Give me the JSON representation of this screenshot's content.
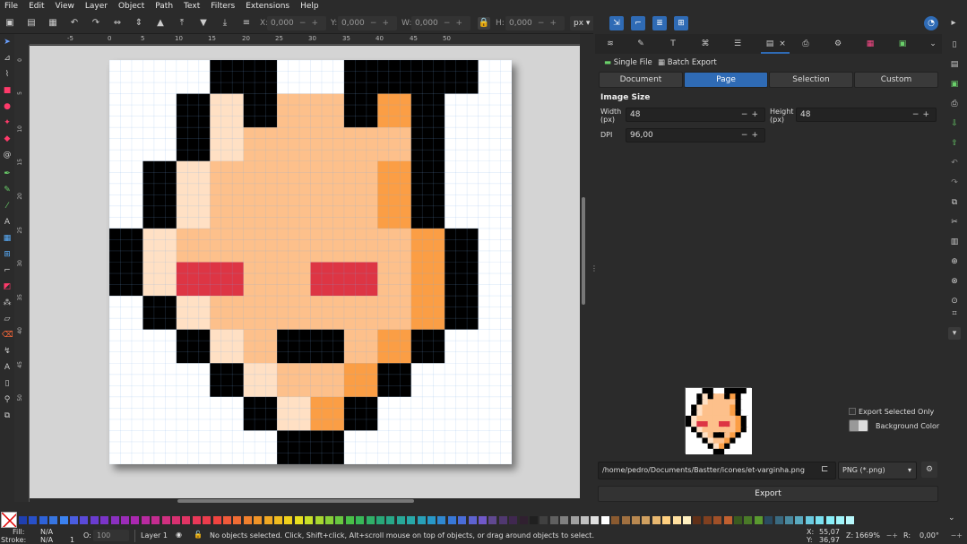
{
  "menu": [
    "File",
    "Edit",
    "View",
    "Layer",
    "Object",
    "Path",
    "Text",
    "Filters",
    "Extensions",
    "Help"
  ],
  "toolbar": {
    "x_label": "X:",
    "x_value": "0,000",
    "y_label": "Y:",
    "y_value": "0,000",
    "w_label": "W:",
    "w_value": "0,000",
    "h_label": "H:",
    "h_value": "0,000",
    "unit": "px"
  },
  "ruler_h": [
    "-5",
    "0",
    "5",
    "10",
    "15",
    "20",
    "25",
    "30",
    "35",
    "40",
    "45",
    "50"
  ],
  "ruler_v": [
    "0",
    "5",
    "10",
    "15",
    "20",
    "25",
    "30",
    "35",
    "40",
    "45",
    "50"
  ],
  "pixel_art": {
    "cols": 12,
    "rows": 12,
    "palette": {
      "0": "#ffffff",
      "K": "#000000",
      "L": "#ffe0c4",
      "S": "#fdc08b",
      "O": "#fb9e45",
      "R": "#dd3544"
    },
    "grid": [
      "000KK00KKKK0",
      "00KLKSSKOK00",
      "00KLSSSSSK00",
      "0KLSSSSSOK0",
      "0KLSSSSSOK0",
      "KLSSSSSSSOK",
      "KLRRSSRRSOK",
      "0KLSSSSSSOK",
      "00KLSKKSOK00",
      "000KLSSOK000",
      "0000KLOK0000",
      "00000KK00000"
    ]
  },
  "dock": {
    "tab_close": "×",
    "subtabs": [
      "Single File",
      "Batch Export"
    ],
    "segments": [
      "Document",
      "Page",
      "Selection",
      "Custom"
    ],
    "active_segment": "Page",
    "image_size_label": "Image Size",
    "width_label": "Width (px)",
    "width_value": "48",
    "height_label": "Height (px)",
    "height_value": "48",
    "dpi_label": "DPI",
    "dpi_value": "96,00",
    "export_selected_only": "Export Selected Only",
    "background_color": "Background Color",
    "filename": "/home/pedro/Documents/Bastter/icones/et-varginha.png",
    "format": "PNG (*.png)",
    "export_button": "Export"
  },
  "status": {
    "fill_label": "Fill:",
    "fill_value": "N/A",
    "stroke_label": "Stroke:",
    "stroke_value": "N/A",
    "stroke_width": "1",
    "opacity_label": "O:",
    "opacity_value": "100",
    "layer": "Layer 1",
    "message": "No objects selected. Click, Shift+click, Alt+scroll mouse on top of objects, or drag around objects to select.",
    "x_label": "X:",
    "x_value": "55,07",
    "y_label": "Y:",
    "y_value": "36,97",
    "zoom_label": "Z:",
    "zoom_value": "1669%",
    "rot_label": "R:",
    "rot_value": "0,00°"
  },
  "palette_colors": [
    "#1f3fb0",
    "#2850c8",
    "#2e62d8",
    "#3775e0",
    "#3b82f0",
    "#4a5de0",
    "#5a4ad8",
    "#6a3cd0",
    "#7a34c8",
    "#8a30c0",
    "#9a2cb8",
    "#aa28b0",
    "#b82aa0",
    "#c42c90",
    "#d03080",
    "#d83070",
    "#e03464",
    "#e83858",
    "#ec3c4c",
    "#f04440",
    "#f05a3a",
    "#f06c34",
    "#f0802e",
    "#f09428",
    "#f0a824",
    "#f0bc20",
    "#f0d01c",
    "#e8e020",
    "#c8e028",
    "#a8d830",
    "#88d038",
    "#68c840",
    "#48c048",
    "#38b858",
    "#30b068",
    "#28a878",
    "#28a888",
    "#28a898",
    "#28a8a8",
    "#28a0b8",
    "#2898c8",
    "#3088d0",
    "#3878d8",
    "#4a6cd8",
    "#5e62d0",
    "#7058c8",
    "#604890",
    "#503870",
    "#402850",
    "#302030",
    "#202020",
    "#404040",
    "#606060",
    "#808080",
    "#a0a0a0",
    "#c0c0c0",
    "#e0e0e0",
    "#ffffff",
    "#8a5a30",
    "#a07040",
    "#b88850",
    "#d0a060",
    "#e8b870",
    "#ffd080",
    "#ffe0a0",
    "#fff0c0",
    "#603018",
    "#804020",
    "#a05028",
    "#c06030",
    "#3a5a20",
    "#4a7a28",
    "#5a9a30",
    "#2a4a60",
    "#3a6a80",
    "#4a8aa0",
    "#5aaac0",
    "#6acae0",
    "#7ae0f0",
    "#88eef8",
    "#a0f4fa",
    "#b8f8fc"
  ],
  "colors": {
    "accent": "#2f6bb5",
    "canvas_bg": "#d4d4d4",
    "ui_bg": "#2b2b2b"
  }
}
